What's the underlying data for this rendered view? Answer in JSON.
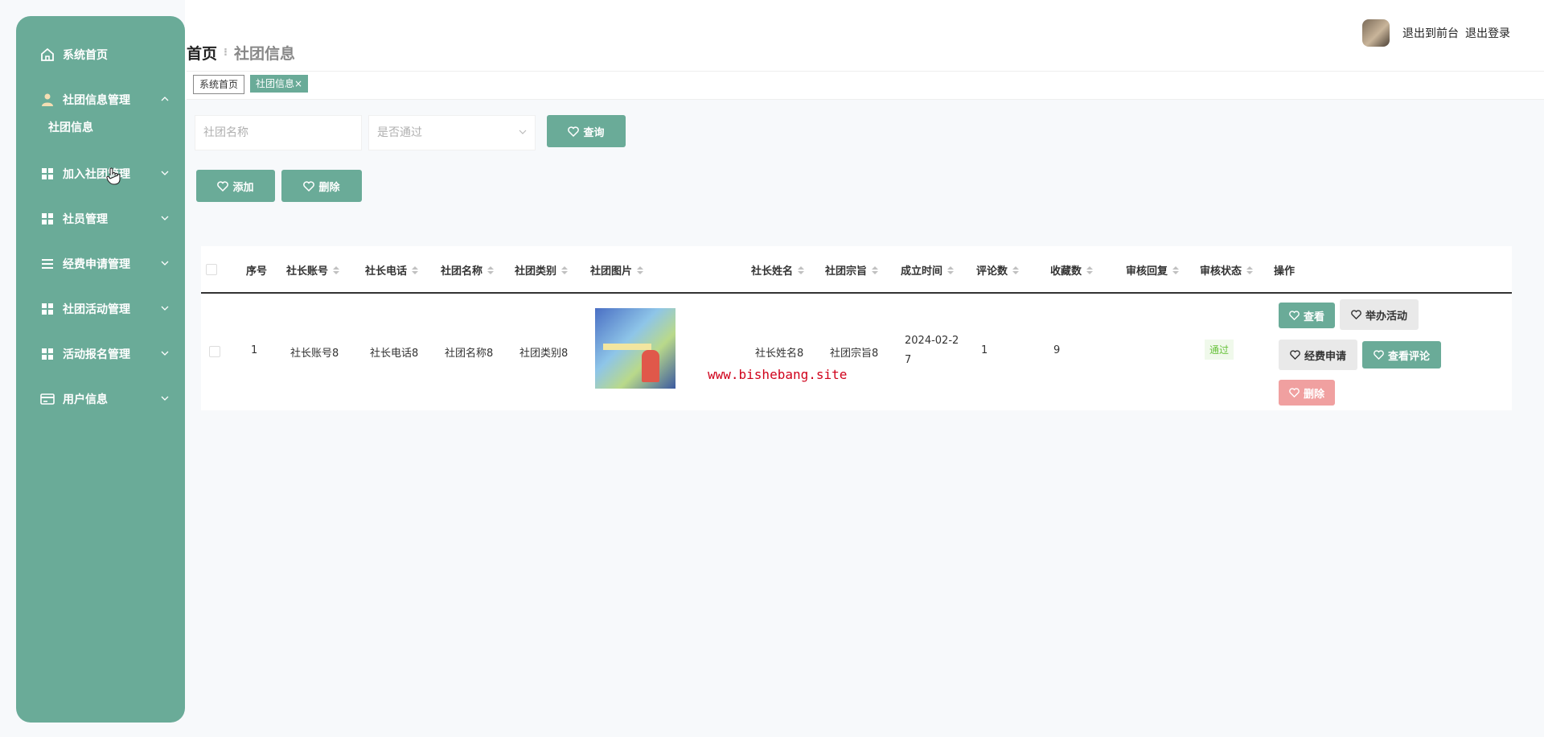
{
  "sidebar": {
    "items": [
      {
        "label": "系统首页",
        "icon": "home-icon"
      },
      {
        "label": "社团信息管理",
        "icon": "user-icon",
        "expanded": true,
        "children": [
          {
            "label": "社团信息"
          }
        ]
      },
      {
        "label": "加入社团管理",
        "icon": "grid-icon"
      },
      {
        "label": "社员管理",
        "icon": "grid-icon"
      },
      {
        "label": "经费申请管理",
        "icon": "list-icon"
      },
      {
        "label": "社团活动管理",
        "icon": "grid-icon"
      },
      {
        "label": "活动报名管理",
        "icon": "grid-icon"
      },
      {
        "label": "用户信息",
        "icon": "card-icon"
      }
    ]
  },
  "header": {
    "breadcrumb_home": "首页",
    "breadcrumb_current": "社团信息",
    "user_links": [
      "退出到前台",
      "退出登录"
    ]
  },
  "tags": [
    "系统首页",
    "社团信息×"
  ],
  "search": {
    "name_placeholder": "社团名称",
    "status_placeholder": "是否通过",
    "query_button": "查询"
  },
  "actions": {
    "add": "添加",
    "delete": "删除"
  },
  "table": {
    "columns": [
      "序号",
      "社长账号",
      "社长电话",
      "社团名称",
      "社团类别",
      "社团图片",
      "社长姓名",
      "社团宗旨",
      "成立时间",
      "评论数",
      "收藏数",
      "审核回复",
      "审核状态",
      "操作"
    ],
    "rows": [
      {
        "index": "1",
        "account": "社长账号8",
        "phone": "社长电话8",
        "name": "社团名称8",
        "category": "社团类别8",
        "leader": "社长姓名8",
        "purpose": "社团宗旨8",
        "date_line1": "2024-02-2",
        "date_line2": "7",
        "comments": "1",
        "favorites": "9",
        "reply": "",
        "status": "通过"
      }
    ],
    "row_buttons": {
      "view": "查看",
      "activity": "举办活动",
      "funding": "经费申请",
      "comments": "查看评论",
      "delete": "删除"
    }
  },
  "watermark": "www.bishebang.site",
  "colors": {
    "accent": "#6aab98",
    "danger": "#f0a0a0",
    "success": "#67c23a"
  }
}
